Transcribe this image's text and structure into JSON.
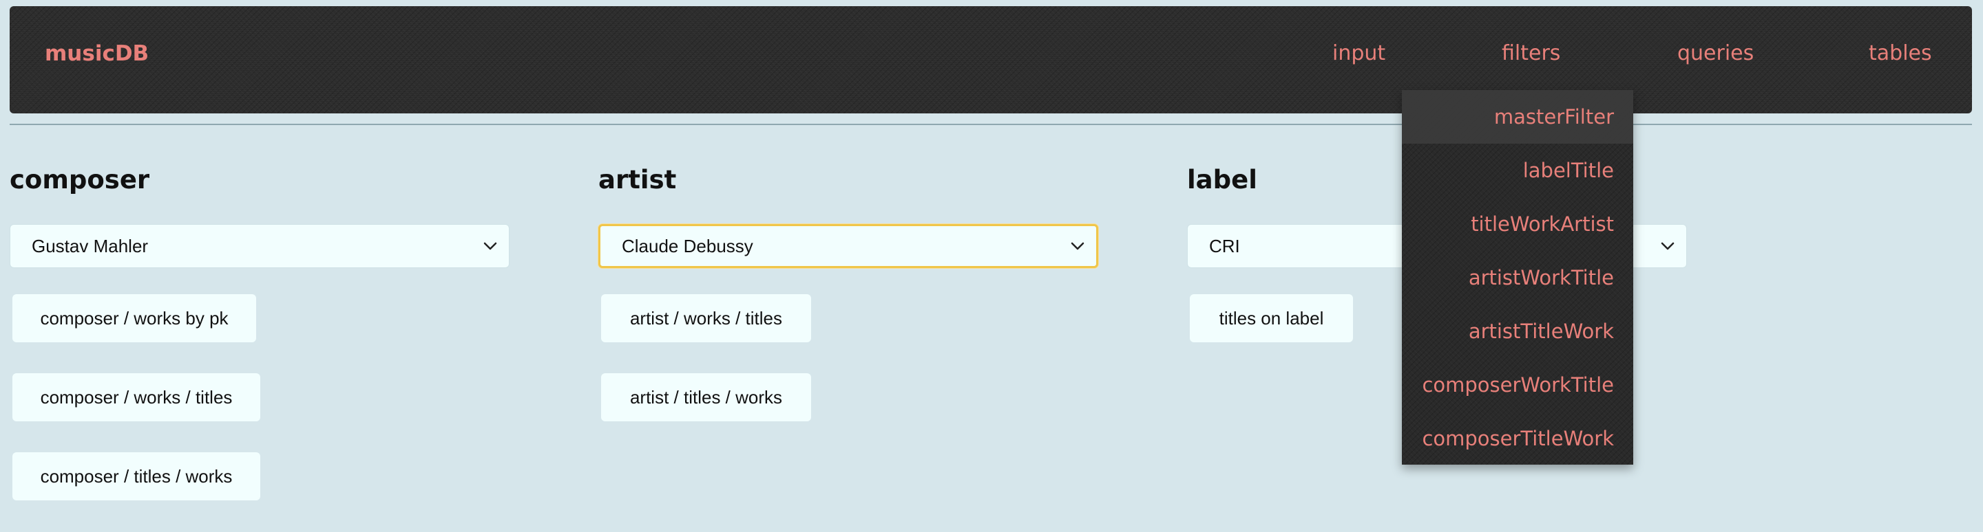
{
  "navbar": {
    "brand": "musicDB",
    "links": {
      "input": "input",
      "filters": "filters",
      "queries": "queries",
      "tables": "tables"
    }
  },
  "filters_menu": {
    "items": [
      "masterFilter",
      "labelTitle",
      "titleWorkArtist",
      "artistWorkTitle",
      "artistTitleWork",
      "composerWorkTitle",
      "composerTitleWork"
    ],
    "highlighted": "masterFilter"
  },
  "columns": {
    "composer": {
      "heading": "composer",
      "selected": "Gustav Mahler",
      "buttons": [
        "composer / works by pk",
        "composer / works / titles",
        "composer / titles / works"
      ]
    },
    "artist": {
      "heading": "artist",
      "selected": "Claude Debussy",
      "buttons": [
        "artist / works / titles",
        "artist / titles / works"
      ]
    },
    "label": {
      "heading": "label",
      "selected": "CRI",
      "buttons": [
        "titles on label"
      ]
    }
  },
  "colors": {
    "accent": "#e8807a",
    "page_bg": "#d6e6eb",
    "navbar_bg": "#2c2c2c",
    "control_bg": "#f2fefe",
    "focus_ring": "#f0c64a"
  },
  "icons": {
    "select_arrow": "chevron-down-icon"
  }
}
